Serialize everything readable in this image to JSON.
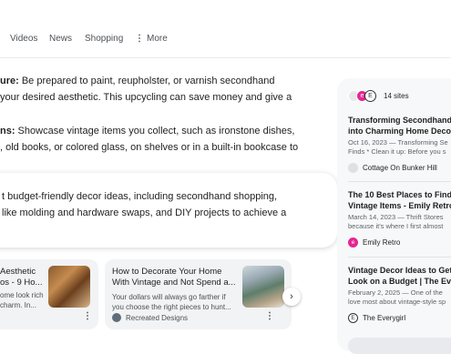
{
  "tabs": [
    "Videos",
    "News",
    "Shopping",
    "More"
  ],
  "paragraphs": [
    {
      "bold": "ure:",
      "lines": [
        " Be prepared to paint, reupholster, or varnish secondhand",
        "your desired aesthetic. This upcycling can save money and give a"
      ]
    },
    {
      "bold": "ns:",
      "lines": [
        " Showcase vintage items you collect, such as ironstone dishes,",
        ", old books, or colored glass, on shelves or in a built-in bookcase to"
      ]
    }
  ],
  "ai_summary": [
    "t budget-friendly decor ideas, including secondhand shopping,",
    "like molding and hardware swaps, and DIY projects to achieve a"
  ],
  "cards": [
    {
      "title": [
        "Aesthetic",
        "os - 9 Ho..."
      ],
      "snippet": [
        "ome look rich",
        "charm. In..."
      ]
    },
    {
      "title": [
        "How to Decorate Your Home",
        "With Vintage and Not Spend a..."
      ],
      "snippet": [
        "Your dollars will always go farther if",
        "you choose the right pieces to hunt..."
      ],
      "source": "Recreated Designs"
    }
  ],
  "sources_panel": {
    "count_label": "14 sites",
    "items": [
      {
        "title": [
          "Transforming Secondhand",
          "into Charming Home Decor"
        ],
        "snippet": [
          "Oct 16, 2023 — Transforming Se",
          "Finds * Clean it up: Before you s"
        ],
        "site": "Cottage On Bunker Hill"
      },
      {
        "title": [
          "The 10 Best Places to Find",
          "Vintage Items - Emily Retro"
        ],
        "snippet": [
          "March 14, 2023 — Thrift Stores",
          "because it's where I first almost"
        ],
        "site": "Emily Retro"
      },
      {
        "title": [
          "Vintage Decor Ideas to Get",
          "Look on a Budget | The Every"
        ],
        "snippet": [
          "February 2, 2025 — One of the",
          "love most about vintage-style sp"
        ],
        "site": "The Everygirl"
      }
    ]
  },
  "colors": {
    "accent_pink": "#e52592",
    "text": "#1f1f1f",
    "muted": "#4d5156"
  }
}
